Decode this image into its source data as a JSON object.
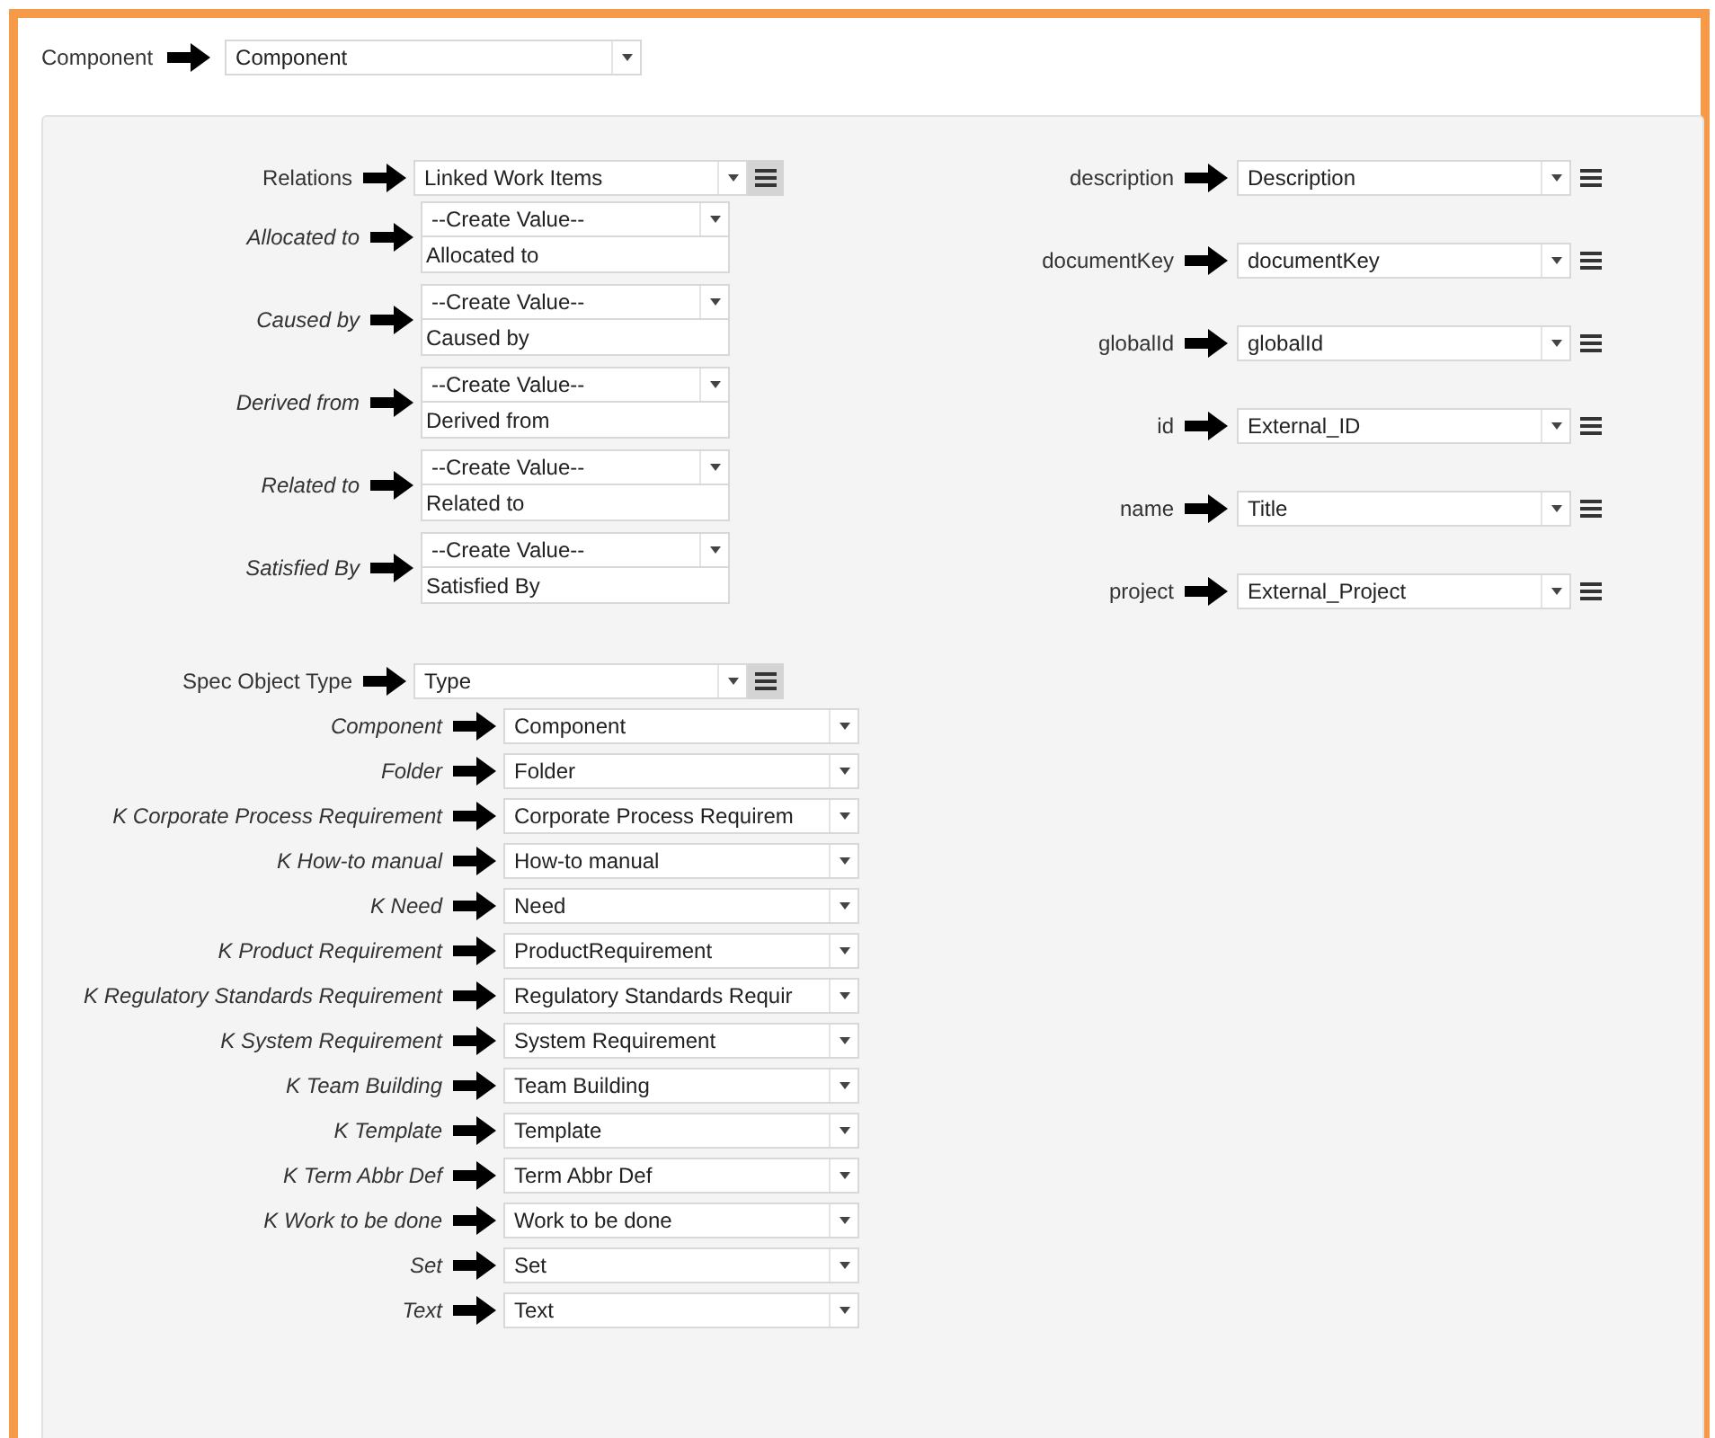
{
  "component": {
    "label": "Component",
    "value": "Component"
  },
  "relations": {
    "label": "Relations",
    "value": "Linked Work Items",
    "items": [
      {
        "label": "Allocated to",
        "create": "--Create Value--",
        "value": "Allocated to"
      },
      {
        "label": "Caused by",
        "create": "--Create Value--",
        "value": "Caused by"
      },
      {
        "label": "Derived from",
        "create": "--Create Value--",
        "value": "Derived from"
      },
      {
        "label": "Related to",
        "create": "--Create Value--",
        "value": "Related to"
      },
      {
        "label": "Satisfied By",
        "create": "--Create Value--",
        "value": "Satisfied By"
      }
    ]
  },
  "spec_object_type": {
    "label": "Spec Object Type",
    "value": "Type",
    "items": [
      {
        "label": "Component",
        "value": "Component"
      },
      {
        "label": "Folder",
        "value": "Folder"
      },
      {
        "label": "K Corporate Process Requirement",
        "value": "Corporate Process Requirem"
      },
      {
        "label": "K How-to manual",
        "value": "How-to manual"
      },
      {
        "label": "K Need",
        "value": "Need"
      },
      {
        "label": "K Product Requirement",
        "value": "ProductRequirement"
      },
      {
        "label": "K Regulatory Standards Requirement",
        "value": "Regulatory Standards Requir"
      },
      {
        "label": "K System Requirement",
        "value": "System Requirement"
      },
      {
        "label": "K Team Building",
        "value": "Team Building"
      },
      {
        "label": "K Template",
        "value": "Template"
      },
      {
        "label": "K Term Abbr Def",
        "value": "Term Abbr Def"
      },
      {
        "label": "K Work to be done",
        "value": "Work to be done"
      },
      {
        "label": "Set",
        "value": "Set"
      },
      {
        "label": "Text",
        "value": "Text"
      }
    ]
  },
  "attributes": [
    {
      "label": "description",
      "value": "Description"
    },
    {
      "label": "documentKey",
      "value": "documentKey"
    },
    {
      "label": "globalId",
      "value": "globalId"
    },
    {
      "label": "id",
      "value": "External_ID"
    },
    {
      "label": "name",
      "value": "Title"
    },
    {
      "label": "project",
      "value": "External_Project"
    }
  ]
}
